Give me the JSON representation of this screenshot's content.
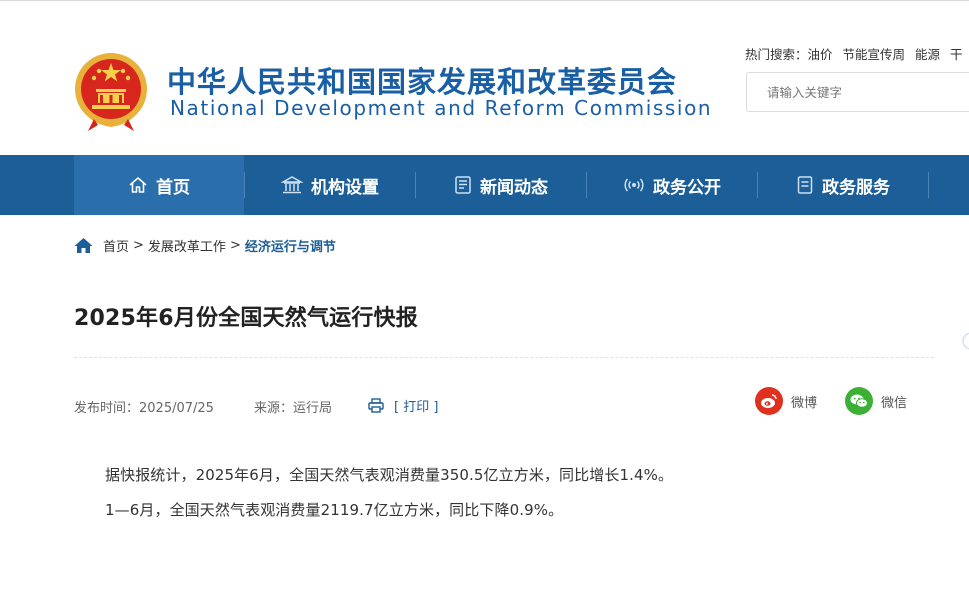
{
  "header": {
    "title_cn": "中华人民共和国国家发展和改革委员会",
    "title_en": "National Development and Reform Commission",
    "hot_label": "热门搜索：",
    "hot_keywords": [
      "油价",
      "节能宣传周",
      "能源",
      "干"
    ],
    "search_placeholder": "请输入关键字"
  },
  "nav": {
    "items": [
      {
        "label": "首页",
        "icon": "home-icon"
      },
      {
        "label": "机构设置",
        "icon": "building-icon"
      },
      {
        "label": "新闻动态",
        "icon": "newspaper-icon"
      },
      {
        "label": "政务公开",
        "icon": "broadcast-icon"
      },
      {
        "label": "政务服务",
        "icon": "document-icon"
      }
    ]
  },
  "breadcrumb": {
    "items": [
      "首页",
      "发展改革工作",
      "经济运行与调节"
    ],
    "separator": ">"
  },
  "article": {
    "title": "2025年6月份全国天然气运行快报",
    "publish_time": "发布时间：2025/07/25",
    "source": "来源：运行局",
    "print_label": "[ 打印 ]",
    "share_weibo": "微博",
    "share_wechat": "微信",
    "paragraphs": [
      "据快报统计，2025年6月，全国天然气表观消费量350.5亿立方米，同比增长1.4%。",
      "1—6月，全国天然气表观消费量2119.7亿立方米，同比下降0.9%。"
    ]
  },
  "colors": {
    "brand_blue": "#1c5e98",
    "nav_active": "#2a6eab",
    "weibo_red": "#e0301e",
    "wechat_green": "#3cb034"
  }
}
